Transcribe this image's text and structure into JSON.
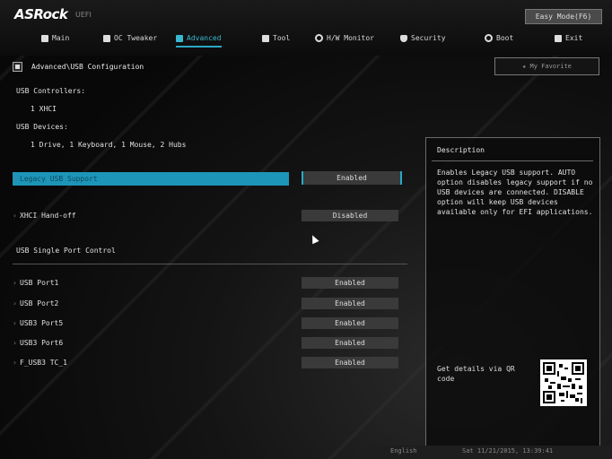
{
  "header": {
    "logo": "ASRock",
    "logo_sub": "UEFI",
    "easy_mode": "Easy Mode(F6)"
  },
  "nav": {
    "items": [
      {
        "label": "Main",
        "icon": "main-icon"
      },
      {
        "label": "OC Tweaker",
        "icon": "rocket-icon"
      },
      {
        "label": "Advanced",
        "icon": "advanced-icon"
      },
      {
        "label": "Tool",
        "icon": "tool-icon"
      },
      {
        "label": "H/W Monitor",
        "icon": "monitor-icon"
      },
      {
        "label": "Security",
        "icon": "shield-icon"
      },
      {
        "label": "Boot",
        "icon": "power-icon"
      },
      {
        "label": "Exit",
        "icon": "exit-icon"
      }
    ],
    "active": "Advanced"
  },
  "breadcrumb": "Advanced\\USB Configuration",
  "favorite": "My Favorite",
  "info": {
    "controllers_label": "USB Controllers:",
    "controllers_value": "1 XHCI",
    "devices_label": "USB Devices:",
    "devices_value": "1 Drive, 1 Keyboard, 1 Mouse, 2 Hubs"
  },
  "rows": [
    {
      "label": "Legacy USB Support",
      "value": "Enabled"
    },
    {
      "label": "XHCI Hand-off",
      "value": "Disabled"
    }
  ],
  "section_title": "USB Single Port Control",
  "ports": [
    {
      "label": "USB Port1",
      "value": "Enabled"
    },
    {
      "label": "USB Port2",
      "value": "Enabled"
    },
    {
      "label": "USB3 Port5",
      "value": "Enabled"
    },
    {
      "label": "USB3 Port6",
      "value": "Enabled"
    },
    {
      "label": "F_USB3 TC_1",
      "value": "Enabled"
    }
  ],
  "description": {
    "title": "Description",
    "text": "Enables Legacy USB support. AUTO option disables legacy support if no USB devices are connected. DISABLE option will keep USB devices available only for EFI applications.",
    "qr_label": "Get details via QR code"
  },
  "bottom": {
    "left": "English",
    "right": "Sat 11/21/2015, 13:39:41"
  },
  "colors": {
    "accent": "#2aa8c4",
    "highlight": "#1d95b8"
  }
}
